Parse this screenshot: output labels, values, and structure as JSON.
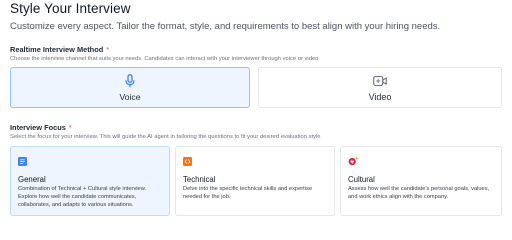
{
  "header": {
    "title": "Style Your Interview",
    "subtitle": "Customize every aspect. Tailor the format, style, and requirements to best align with your hiring needs."
  },
  "method": {
    "label": "Realtime Interview Method",
    "required_mark": "*",
    "hint": "Choose the interview channel that suits your needs. Candidates can interact with your interviewer through voice or video",
    "options": [
      {
        "label": "Voice",
        "icon": "microphone-icon",
        "selected": true
      },
      {
        "label": "Video",
        "icon": "video-icon",
        "selected": false
      }
    ]
  },
  "focus": {
    "label": "Interview Focus",
    "required_mark": "*",
    "hint": "Select the focus for your interview. This will guide the AI agent in tailoring the questions to fit your desired evaluation style",
    "options": [
      {
        "title": "General",
        "icon": "document-icon",
        "selected": true,
        "description": "Combination of Technical + Cultural style interview. Explore how well the candidate communicates, collaborates, and adapts to various situations."
      },
      {
        "title": "Technical",
        "icon": "code-file-icon",
        "selected": false,
        "description": "Delve into the specific technical skills and expertise needed for the job."
      },
      {
        "title": "Cultural",
        "icon": "sparkle-heart-icon",
        "selected": false,
        "description": "Assess how well the candidate's personal goals, values, and work ethics align with the company."
      }
    ]
  },
  "colors": {
    "accent": "#3b82f6",
    "selected_bg": "#eef5ff",
    "required": "#ef4444",
    "technical_icon": "#f97316",
    "cultural_icon": "#e11d48"
  }
}
